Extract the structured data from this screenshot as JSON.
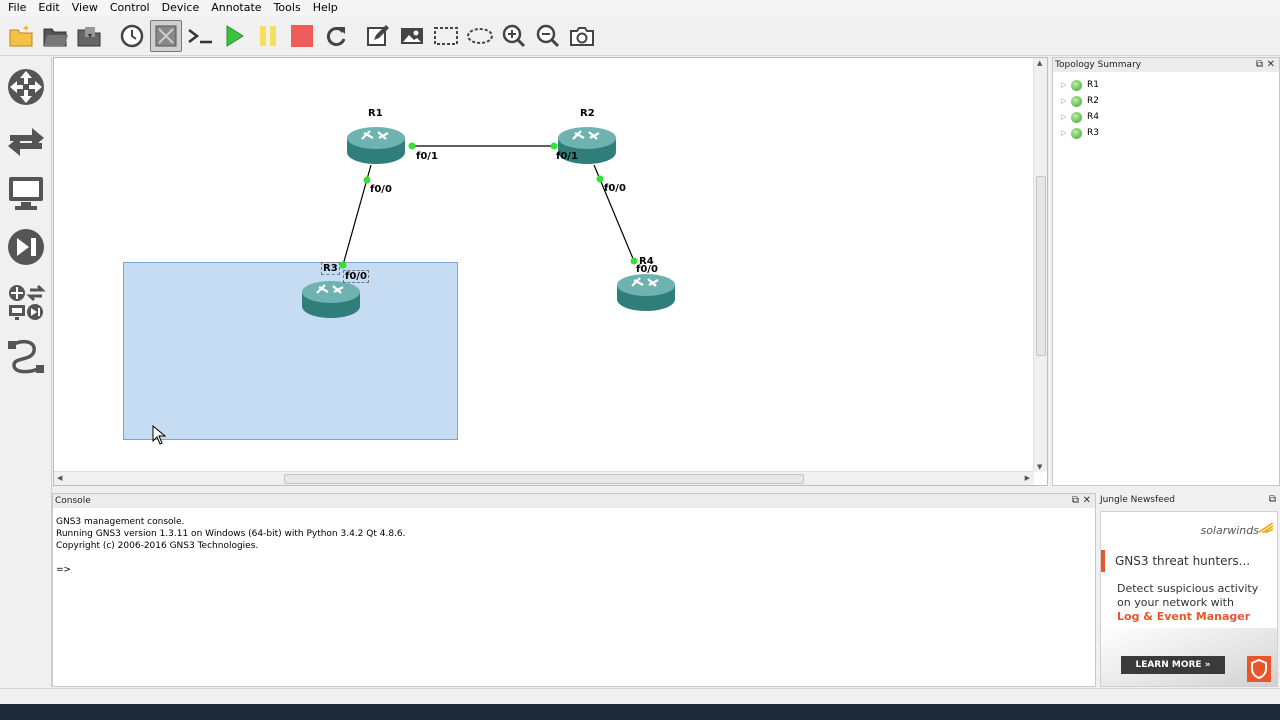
{
  "menu": [
    "File",
    "Edit",
    "View",
    "Control",
    "Device",
    "Annotate",
    "Tools",
    "Help"
  ],
  "canvas": {
    "nodes": {
      "r1": "R1",
      "r2": "R2",
      "r3": "R3",
      "r4": "R4"
    },
    "ports": {
      "r1_r2_side": "f0/1",
      "r2_r1_side": "f0/1",
      "r1_r3_side": "f0/0",
      "r3_r1_side": "f0/0",
      "r2_r4_side": "f0/0",
      "r4_r2_side": "f0/0"
    },
    "link_color": "#000000",
    "port_color": "#35e035",
    "selection_fill": "#c5dcf3"
  },
  "topology_summary": {
    "title": "Topology Summary",
    "items": [
      "R1",
      "R2",
      "R4",
      "R3"
    ],
    "status_color": "#3fa02a"
  },
  "console": {
    "title": "Console",
    "lines": [
      "GNS3 management console.",
      "Running GNS3 version 1.3.11 on Windows (64-bit) with Python 3.4.2 Qt 4.8.6.",
      "Copyright (c) 2006-2016 GNS3 Technologies.",
      "=>"
    ]
  },
  "newsfeed": {
    "title": "Jungle Newsfeed",
    "ad": {
      "brand": "solarwinds",
      "headline": "GNS3 threat hunters...",
      "body": "Detect suspicious activity on your network with",
      "product": "Log & Event Manager",
      "cta": "LEARN MORE »",
      "accent": "#e8562a"
    }
  }
}
